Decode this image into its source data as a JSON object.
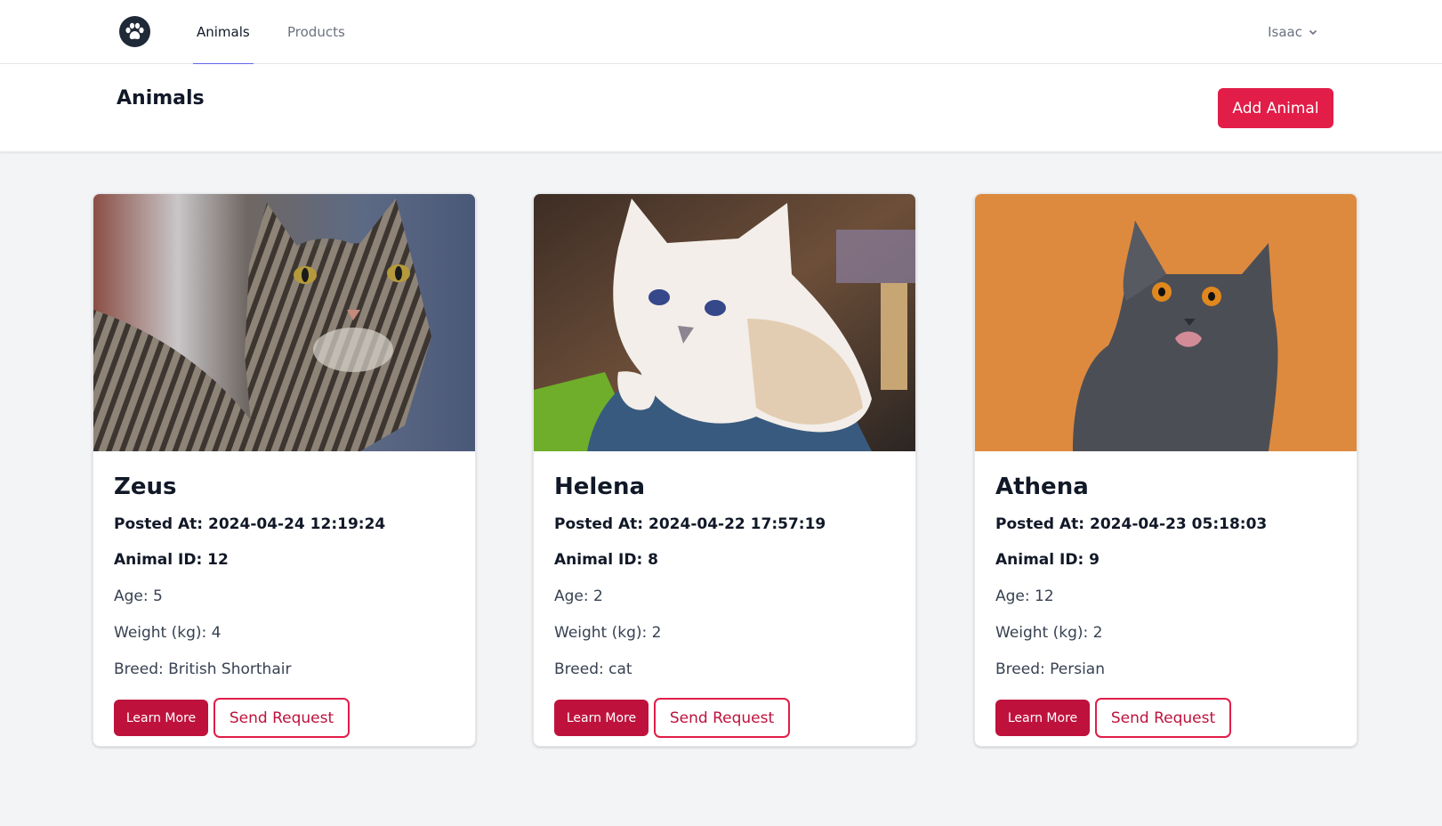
{
  "nav": {
    "logo_icon": "paw-icon",
    "tabs": [
      {
        "label": "Animals",
        "active": true
      },
      {
        "label": "Products",
        "active": false
      }
    ],
    "user": {
      "name": "Isaac",
      "icon": "chevron-down-icon"
    }
  },
  "header": {
    "title": "Animals",
    "add_button_label": "Add Animal"
  },
  "colors": {
    "accent": "#e11d48",
    "accent_dark": "#be123c",
    "active_tab_underline": "#6366f1"
  },
  "cards": [
    {
      "name": "Zeus",
      "posted": "Posted At: 2024-04-24 12:19:24",
      "animal_id": "Animal ID: 12",
      "age": "Age: 5",
      "weight": "Weight (kg): 4",
      "breed": "Breed: British Shorthair",
      "learn_label": "Learn More",
      "request_label": "Send Request"
    },
    {
      "name": "Helena",
      "posted": "Posted At: 2024-04-22 17:57:19",
      "animal_id": "Animal ID: 8",
      "age": "Age: 2",
      "weight": "Weight (kg): 2",
      "breed": "Breed: cat",
      "learn_label": "Learn More",
      "request_label": "Send Request"
    },
    {
      "name": "Athena",
      "posted": "Posted At: 2024-04-23 05:18:03",
      "animal_id": "Animal ID: 9",
      "age": "Age: 12",
      "weight": "Weight (kg): 2",
      "breed": "Breed: Persian",
      "learn_label": "Learn More",
      "request_label": "Send Request"
    }
  ]
}
